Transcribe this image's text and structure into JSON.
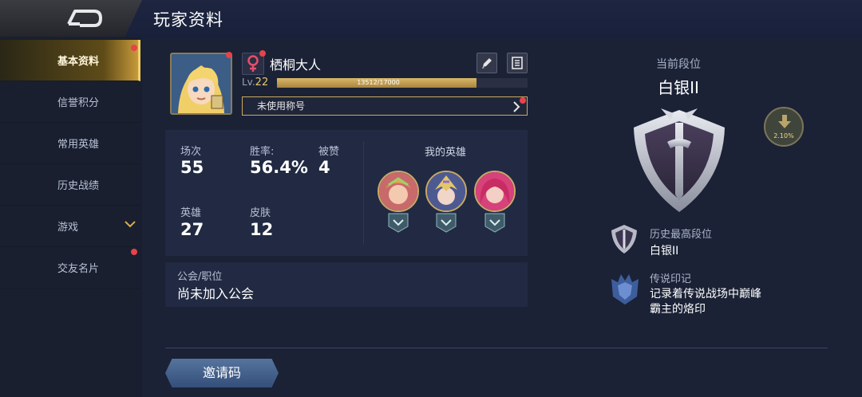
{
  "header": {
    "title": "玩家资料"
  },
  "sidebar": {
    "items": [
      {
        "label": "基本资料"
      },
      {
        "label": "信誉积分"
      },
      {
        "label": "常用英雄"
      },
      {
        "label": "历史战绩"
      },
      {
        "label": "游戏"
      },
      {
        "label": "交友名片"
      }
    ]
  },
  "profile": {
    "name": "栖桐大人",
    "level_prefix": "Lv.",
    "level": "22",
    "exp_text": "13512/17000",
    "exp_fraction": 0.795,
    "title_placeholder": "未使用称号"
  },
  "stats": {
    "matches_label": "场次",
    "matches": "55",
    "winrate_label": "胜率:",
    "winrate": "56.4%",
    "likes_label": "被赞",
    "likes": "4",
    "heroes_label": "英雄",
    "heroes": "27",
    "skins_label": "皮肤",
    "skins": "12"
  },
  "my_heroes": {
    "title": "我的英雄"
  },
  "guild": {
    "label": "公会/职位",
    "value": "尚未加入公会"
  },
  "invite": {
    "label": "邀请码"
  },
  "rank": {
    "caption": "当前段位",
    "current": "白银II",
    "protect_percent": "2.10%",
    "best_label": "历史最高段位",
    "best_value": "白银II",
    "legend_label": "传说印记",
    "legend_desc": "记录着传说战场中巅峰霸主的烙印"
  },
  "colors": {
    "accent_gold": "#c9a95e",
    "notification_red": "#e6434a",
    "background": "#1b2236"
  },
  "icons": {
    "back": "back-arrow-icon",
    "female": "female-icon",
    "edit": "pencil-icon",
    "record": "notebook-icon",
    "protect": "down-arrow-icon"
  }
}
